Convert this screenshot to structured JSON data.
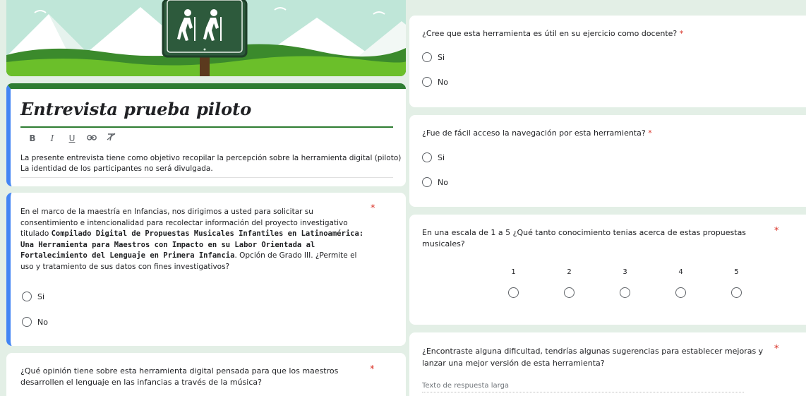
{
  "header": {
    "sign_icon": "hiker-sign-icon"
  },
  "title_card": {
    "title": "Entrevista prueba piloto",
    "toolbar": [
      {
        "name": "bold-icon",
        "glyph": "B"
      },
      {
        "name": "italic-icon",
        "glyph": "I"
      },
      {
        "name": "underline-icon",
        "glyph": "U"
      },
      {
        "name": "link-icon",
        "glyph": "⊖"
      },
      {
        "name": "clear-format-icon",
        "glyph": "T̸"
      }
    ],
    "description_line1": "La presente entrevista tiene como objetivo recopilar la percepción sobre la herramienta digital (piloto)",
    "description_line2": "La identidad de los participantes no será divulgada."
  },
  "consent": {
    "text_pre": "En el marco de la maestría en Infancias, nos dirigimos a usted para solicitar su consentimiento e intencionalidad para recolectar información del proyecto investigativo titulado ",
    "text_bold": "Compilado Digital de Propuestas Musicales Infantiles en Latinoamérica: Una Herramienta para Maestros con Impacto en su Labor Orientada al Fortalecimiento del Lenguaje en Primera Infancia",
    "text_post": ".  Opción de Grado III. ¿Permite el uso y tratamiento de sus datos con fines investigativos?",
    "required_mark": "*",
    "options": [
      "Si",
      "No"
    ]
  },
  "opinion": {
    "question": "¿Qué opinión tiene sobre esta herramienta digital pensada para que los maestros desarrollen el lenguaje en las infancias a través de la música?",
    "required_mark": "*"
  },
  "useful": {
    "question": "¿Cree que esta herramienta es útil en su ejercicio como docente?",
    "required_mark": "*",
    "options": [
      "Si",
      "No"
    ]
  },
  "access": {
    "question": "¿Fue de fácil acceso la navegación por esta herramienta?",
    "required_mark": "*",
    "options": [
      "Si",
      "No"
    ]
  },
  "scale": {
    "question": "En una escala de 1 a 5 ¿Qué tanto conocimiento tenias acerca de estas propuestas musicales?",
    "required_mark": "*",
    "labels": [
      "1",
      "2",
      "3",
      "4",
      "5"
    ]
  },
  "difficulty": {
    "question": "¿Encontraste alguna dificultad, tendrías algunas sugerencias para establecer mejoras y lanzar una mejor versión de esta herramienta?",
    "required_mark": "*",
    "placeholder": "Texto de respuesta larga"
  }
}
